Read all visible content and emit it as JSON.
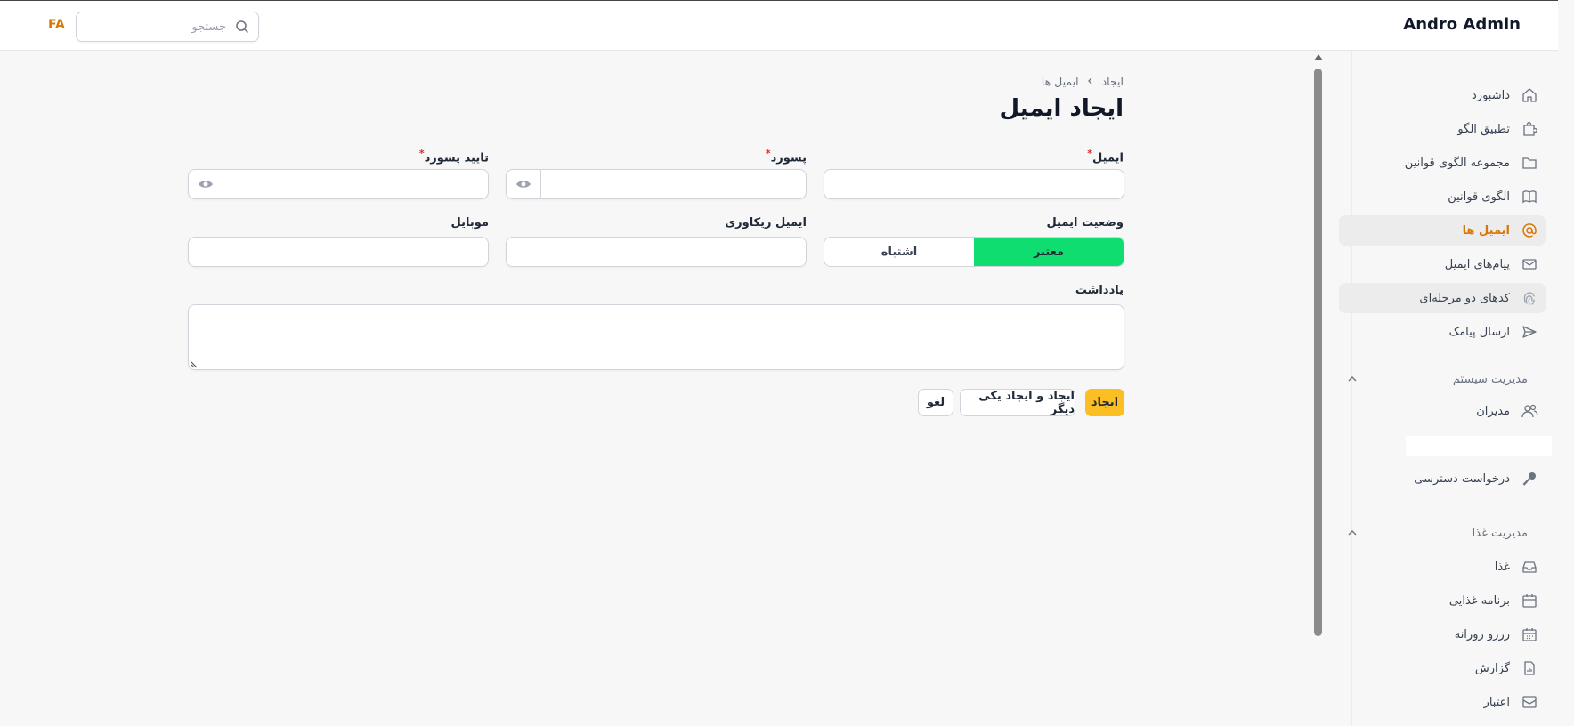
{
  "topbar": {
    "brand": "Andro Admin",
    "lang": "FA",
    "search_placeholder": "جستجو"
  },
  "sidebar": {
    "items": [
      {
        "label": "داشبورد",
        "icon": "home-icon"
      },
      {
        "label": "تطبیق الگو",
        "icon": "puzzle-icon"
      },
      {
        "label": "مجموعه الگوی قوانین",
        "icon": "folder-icon"
      },
      {
        "label": "الگوی قوانین",
        "icon": "book-icon"
      },
      {
        "label": "ایمیل ها",
        "icon": "at-sign-icon"
      },
      {
        "label": "پیام‌های ایمیل",
        "icon": "envelope-icon"
      },
      {
        "label": "کدهای دو مرحله‌ای",
        "icon": "fingerprint-icon"
      },
      {
        "label": "ارسال پیامک",
        "icon": "send-icon"
      }
    ],
    "groups": {
      "system": {
        "title": "مدیریت سیستم",
        "items": [
          {
            "label": "مدیران",
            "icon": "users-icon"
          },
          {
            "label": "درخواست دسترسی",
            "icon": "key-icon"
          }
        ]
      },
      "food": {
        "title": "مدیریت غذا",
        "items": [
          {
            "label": "غذا",
            "icon": "inbox-icon"
          },
          {
            "label": "برنامه غذایی",
            "icon": "calendar-icon"
          },
          {
            "label": "رزرو روزانه",
            "icon": "calendar-days-icon"
          },
          {
            "label": "گزارش",
            "icon": "report-icon"
          },
          {
            "label": "اعتبار",
            "icon": "credit-icon"
          }
        ]
      }
    }
  },
  "main": {
    "breadcrumb": {
      "parent": "ایمیل ها",
      "current": "ایجاد"
    },
    "title": "ایجاد ایمیل",
    "form": {
      "email_label": "ایمیل",
      "password_label": "پسورد",
      "confirm_password_label": "تایید پسورد",
      "status_label": "وضعیت ایمیل",
      "status_options": [
        "معتبر",
        "اشتباه"
      ],
      "status_selected": "معتبر",
      "recovery_email_label": "ایمیل ریکاوری",
      "mobile_label": "موبایل",
      "note_label": "یادداشت",
      "required_mark": "*"
    },
    "actions": {
      "create": "ایجاد",
      "create_another": "ایجاد و ایجاد یکی دیگر",
      "cancel": "لغو"
    }
  },
  "colors": {
    "accent": "#d97706",
    "primary_button": "#fbbf24",
    "toggle_active": "#10dd70"
  }
}
